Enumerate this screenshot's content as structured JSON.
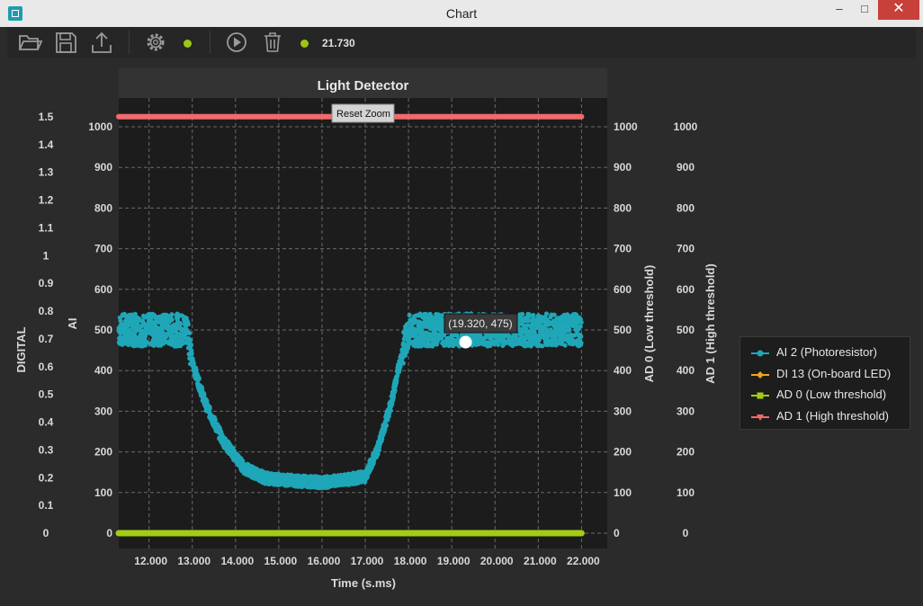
{
  "window": {
    "title": "Chart",
    "minimize": "–",
    "maximize": "□",
    "close": "✕"
  },
  "toolbar": {
    "icons": [
      "open-icon",
      "save-icon",
      "export-icon",
      "gear-icon",
      "play-icon",
      "trash-icon"
    ],
    "elapsed_time": "21.730",
    "status_color": "#9fc513"
  },
  "reset_zoom_label": "Reset Zoom",
  "tooltip": "(19.320, 475)",
  "chart_data": {
    "type": "line",
    "title": "Light Detector",
    "xlabel": "Time (s.ms)",
    "xlim": [
      11.3,
      22.2
    ],
    "xticks": [
      "12.000",
      "13.000",
      "14.000",
      "15.000",
      "16.000",
      "17.000",
      "18.000",
      "19.000",
      "20.000",
      "21.000",
      "22.000"
    ],
    "grid": true,
    "axes": {
      "digital": {
        "label": "DIGITAL",
        "ticks": [
          "0",
          "0.1",
          "0.2",
          "0.3",
          "0.4",
          "0.5",
          "0.6",
          "0.7",
          "0.8",
          "0.9",
          "1",
          "1.1",
          "1.2",
          "1.3",
          "1.4",
          "1.5"
        ],
        "range": [
          0,
          1.5
        ]
      },
      "ai": {
        "label": "AI",
        "ticks": [
          "0",
          "100",
          "200",
          "300",
          "400",
          "500",
          "600",
          "700",
          "800",
          "900",
          "1000"
        ],
        "range": [
          0,
          1000
        ]
      },
      "ad0": {
        "label": "AD 0 (Low threshold)",
        "ticks": [
          "0",
          "100",
          "200",
          "300",
          "400",
          "500",
          "600",
          "700",
          "800",
          "900",
          "1000"
        ],
        "range": [
          0,
          1000
        ]
      },
      "ad1": {
        "label": "AD 1 (High threshold)",
        "ticks": [
          "0",
          "100",
          "200",
          "300",
          "400",
          "500",
          "600",
          "700",
          "800",
          "900",
          "1000"
        ],
        "range": [
          0,
          1000
        ]
      }
    },
    "series": [
      {
        "name": "AI 2 (Photoresistor)",
        "color": "#1fa7b8",
        "x": [
          11.3,
          12.9,
          13.0,
          13.3,
          13.7,
          14.2,
          14.7,
          15.5,
          16.0,
          16.5,
          17.0,
          17.3,
          17.6,
          17.8,
          18.0,
          22.0
        ],
        "y": [
          500,
          500,
          420,
          320,
          230,
          160,
          135,
          128,
          125,
          130,
          140,
          210,
          320,
          420,
          500,
          500
        ],
        "noise": 40
      },
      {
        "name": "DI 13 (On-board LED)",
        "color": "#f5a11f",
        "x": [],
        "y": []
      },
      {
        "name": "AD 0 (Low threshold)",
        "color": "#a4cc14",
        "x": [
          11.3,
          22.0
        ],
        "y": [
          0,
          0
        ]
      },
      {
        "name": "AD 1 (High threshold)",
        "color": "#f26a6a",
        "x": [
          11.3,
          22.0
        ],
        "y": [
          1025,
          1025
        ]
      }
    ],
    "legend_position": "right"
  }
}
